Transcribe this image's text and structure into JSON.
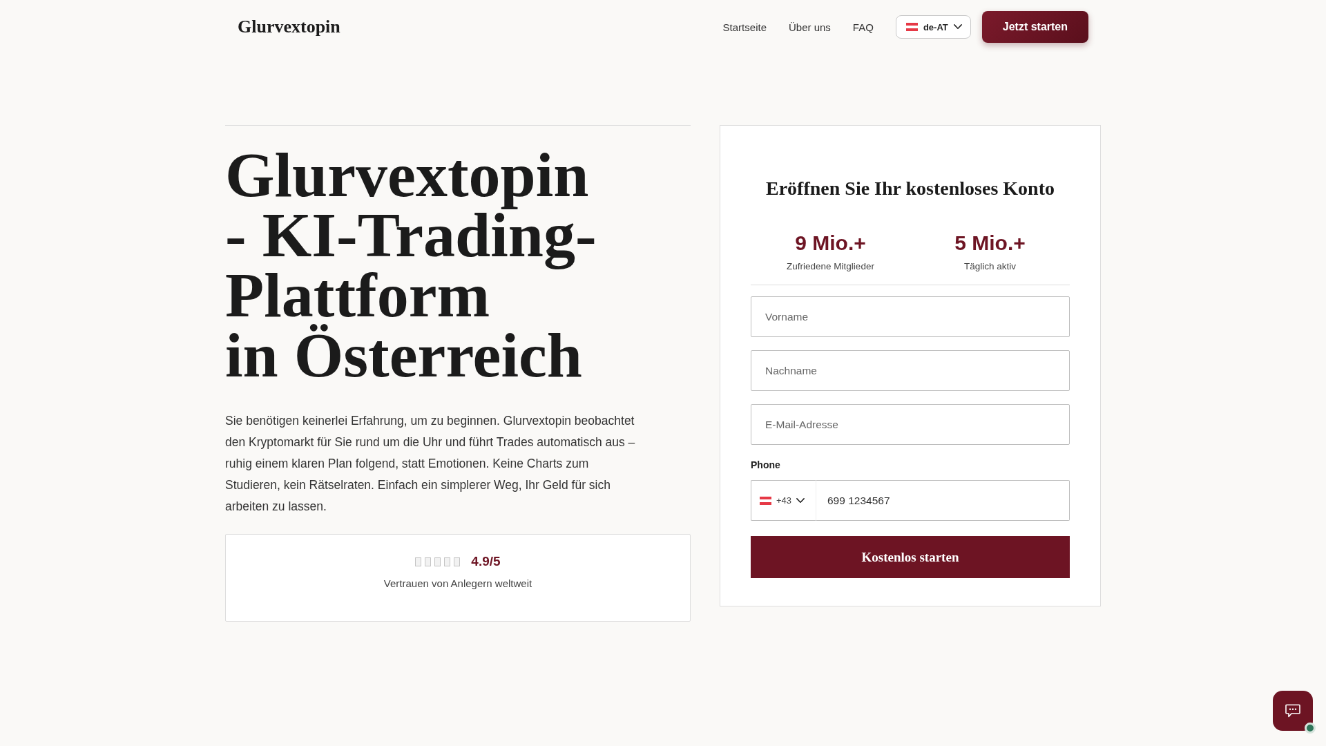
{
  "header": {
    "logo": "Glurvextopin",
    "nav": [
      {
        "label": "Startseite"
      },
      {
        "label": "Über uns"
      },
      {
        "label": "FAQ"
      }
    ],
    "language": {
      "code": "de-AT"
    },
    "cta": "Jetzt starten"
  },
  "hero": {
    "title_lines": [
      "Glurvextopin - KI-Trading-Plattform",
      "in Österreich"
    ],
    "description": "Sie benötigen keinerlei Erfahrung, um zu beginnen. Glurvextopin beobachtet den Kryptomarkt für Sie rund um die Uhr und führt Trades automatisch aus – ruhig einem klaren Plan folgend, statt Emotionen. Keine Charts zum Studieren, kein Rätselraten. Einfach ein simplerer Weg, Ihr Geld für sich arbeiten zu lassen.",
    "rating": {
      "score": "4.9/5",
      "caption": "Vertrauen von Anlegern weltweit"
    }
  },
  "signup": {
    "title": "Eröffnen Sie Ihr kostenloses Konto",
    "stats": [
      {
        "value": "9 Mio.+",
        "label": "Zufriedene Mitglieder"
      },
      {
        "value": "5 Mio.+",
        "label": "Täglich aktiv"
      }
    ],
    "fields": [
      {
        "placeholder": "Vorname"
      },
      {
        "placeholder": "Nachname"
      },
      {
        "placeholder": "E-Mail-Adresse"
      }
    ],
    "phone": {
      "label": "Phone",
      "dial_code": "+43",
      "value": "699 1234567"
    },
    "submit": "Kostenlos starten"
  },
  "chat_widget": {
    "online": true
  }
}
